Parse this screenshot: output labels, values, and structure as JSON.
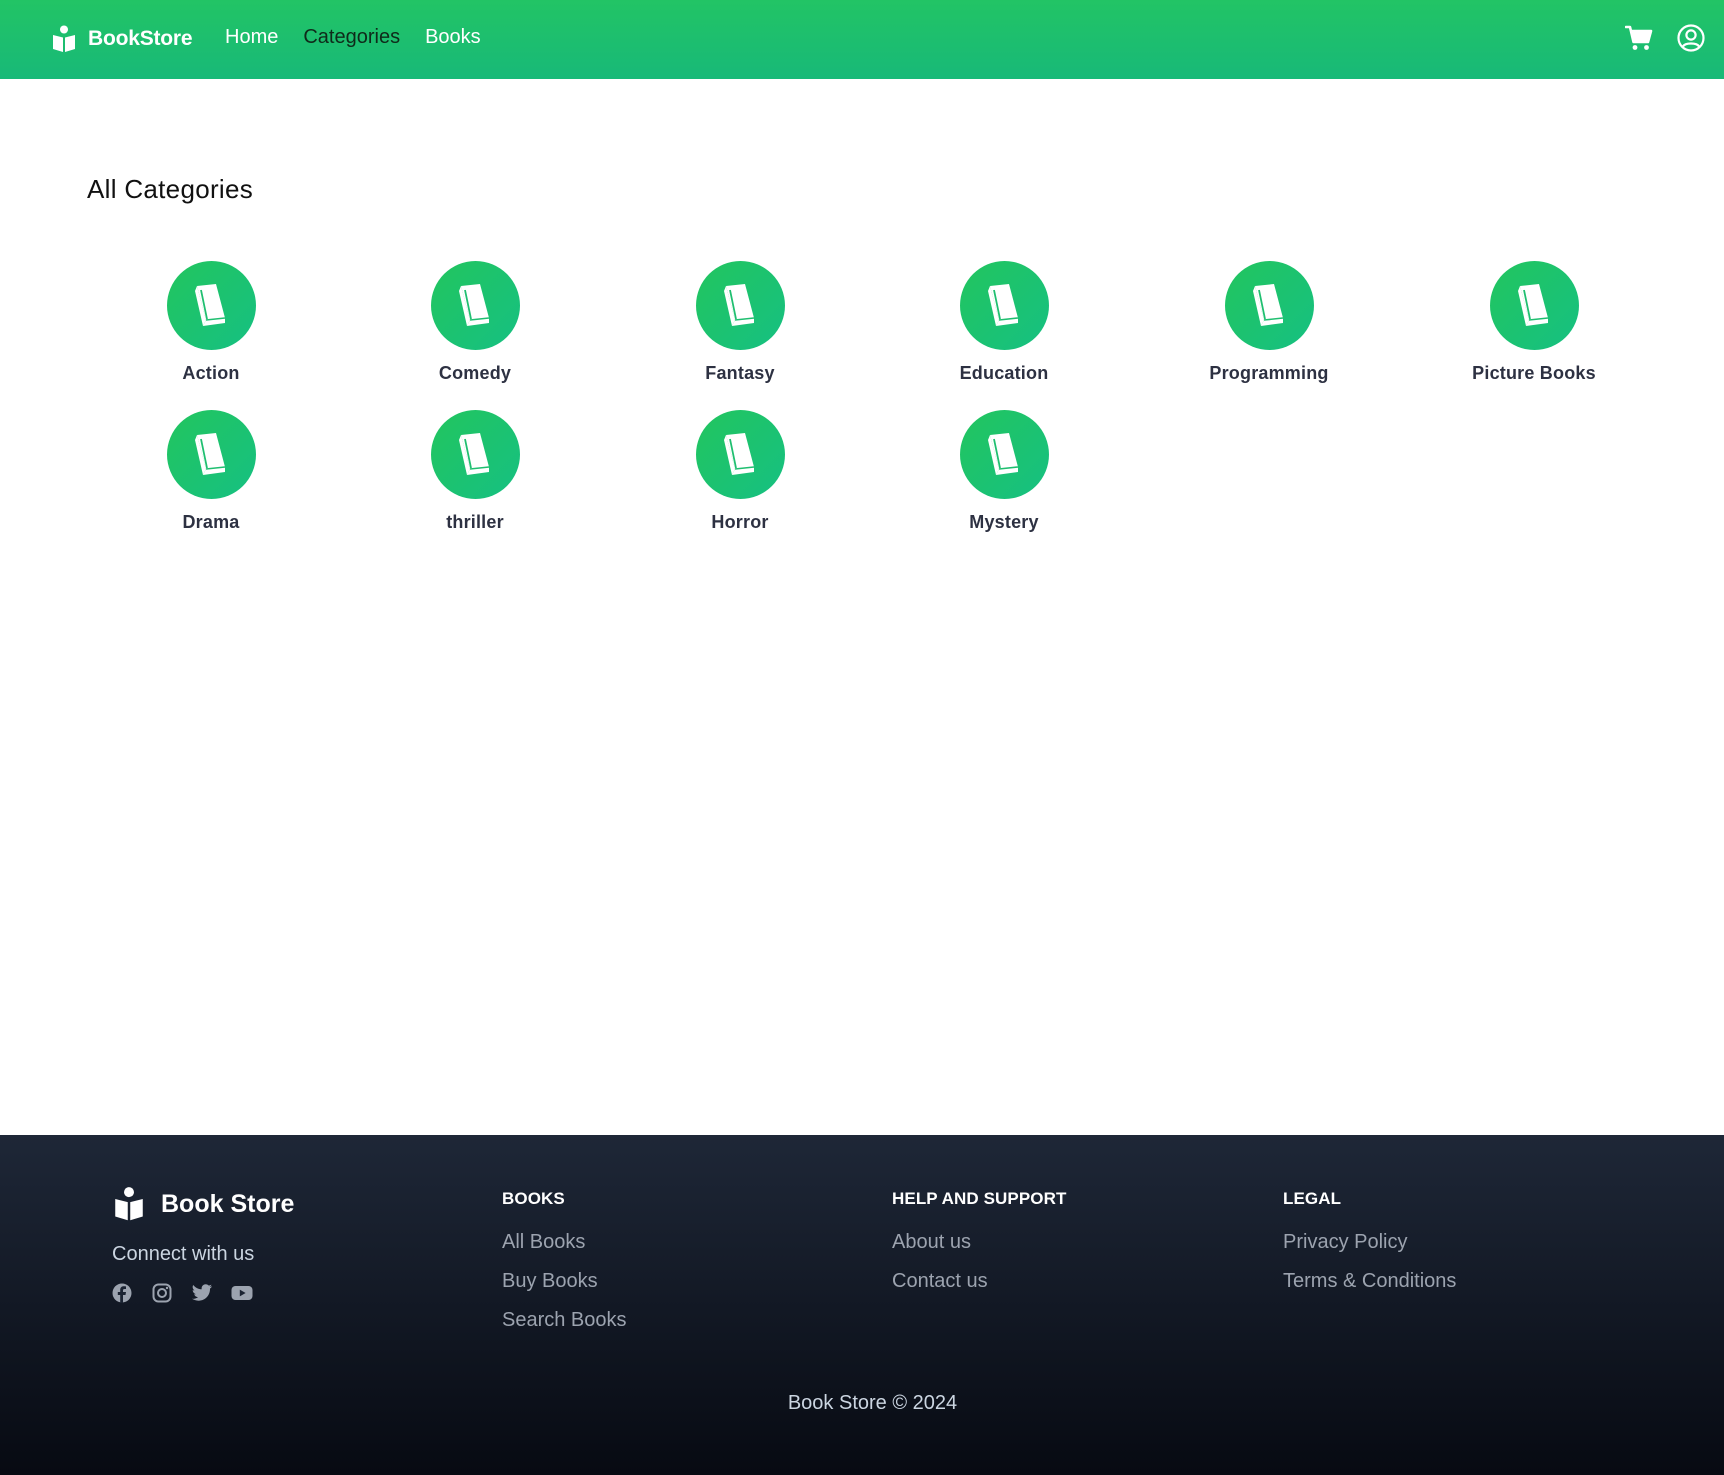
{
  "brand": {
    "name": "BookStore",
    "icon": "book-reader-icon"
  },
  "nav": {
    "links": [
      {
        "label": "Home",
        "active": false
      },
      {
        "label": "Categories",
        "active": true
      },
      {
        "label": "Books",
        "active": false
      }
    ],
    "icons": [
      "cart-icon",
      "user-circle-icon"
    ]
  },
  "main": {
    "title": "All Categories",
    "categories": [
      {
        "label": "Action",
        "icon": "book-icon"
      },
      {
        "label": "Comedy",
        "icon": "book-icon"
      },
      {
        "label": "Fantasy",
        "icon": "book-icon"
      },
      {
        "label": "Education",
        "icon": "book-icon"
      },
      {
        "label": "Programming",
        "icon": "book-icon"
      },
      {
        "label": "Picture Books",
        "icon": "book-icon"
      },
      {
        "label": "Drama",
        "icon": "book-icon"
      },
      {
        "label": "thriller",
        "icon": "book-icon"
      },
      {
        "label": "Horror",
        "icon": "book-icon"
      },
      {
        "label": "Mystery",
        "icon": "book-icon"
      }
    ]
  },
  "footer": {
    "brand": "Book Store",
    "connect": "Connect with us",
    "social": [
      "facebook-icon",
      "instagram-icon",
      "twitter-icon",
      "youtube-icon"
    ],
    "columns": [
      {
        "heading": "BOOKS",
        "links": [
          "All Books",
          "Buy Books",
          "Search Books"
        ]
      },
      {
        "heading": "HELP AND SUPPORT",
        "links": [
          "About us",
          "Contact us"
        ]
      },
      {
        "heading": "LEGAL",
        "links": [
          "Privacy Policy",
          "Terms & Conditions"
        ]
      }
    ],
    "copyright": "Book Store © 2024"
  },
  "colors": {
    "header_green": "#22c465",
    "category_circle": "#22c55e",
    "footer_bg": "#1e2737"
  }
}
